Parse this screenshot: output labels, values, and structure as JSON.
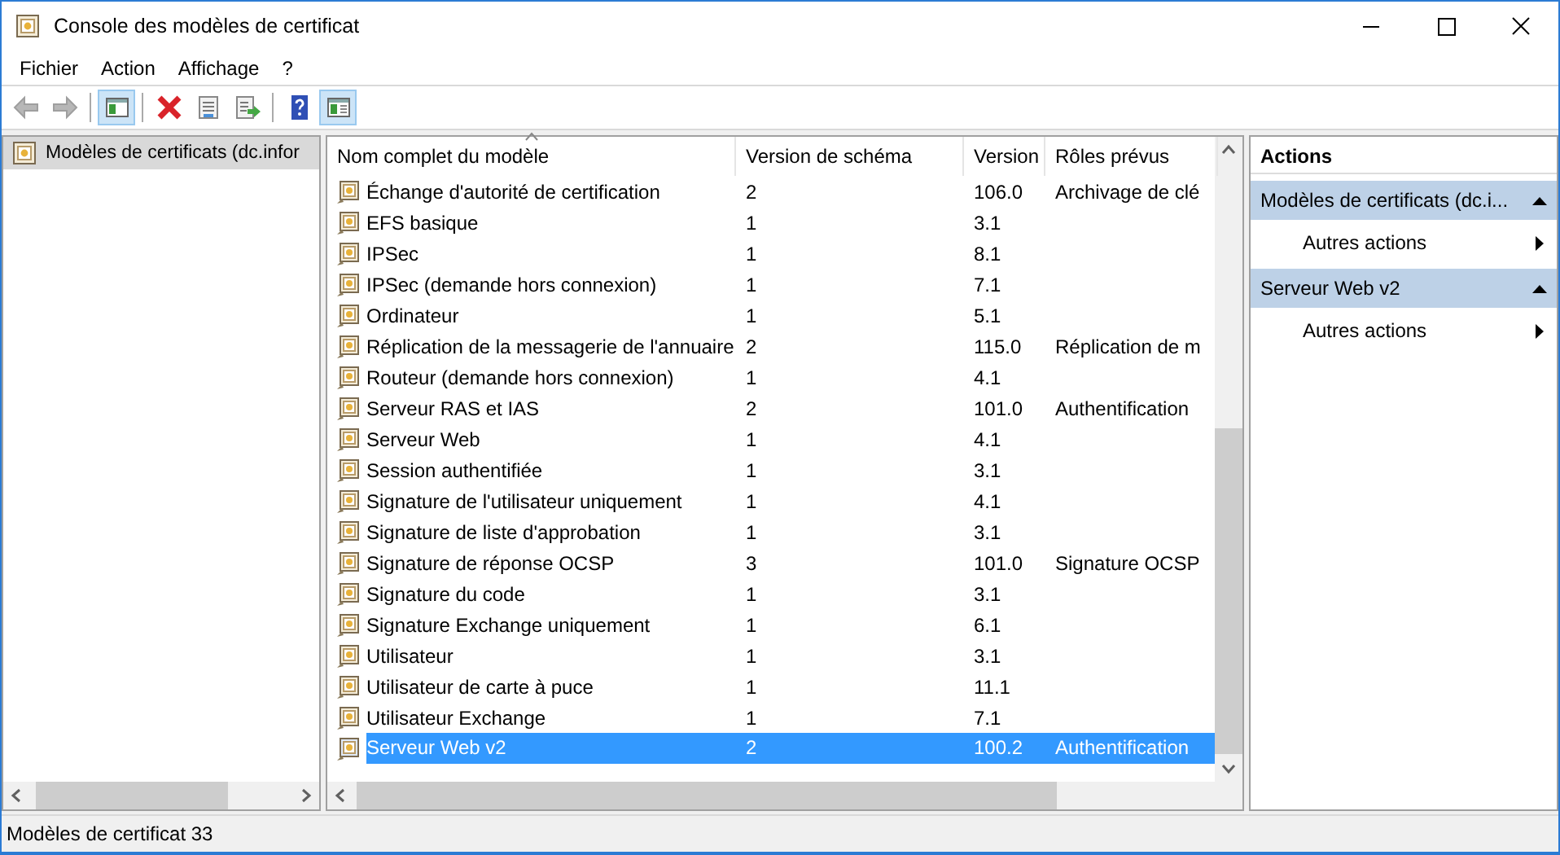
{
  "window": {
    "title": "Console des modèles de certificat"
  },
  "menu": [
    "Fichier",
    "Action",
    "Affichage",
    "?"
  ],
  "toolbar": [
    {
      "kind": "back",
      "disabled": true,
      "pressed": false
    },
    {
      "kind": "forward",
      "disabled": true,
      "pressed": false
    },
    {
      "kind": "tree-pane",
      "disabled": false,
      "pressed": true
    },
    {
      "kind": "delete",
      "disabled": false,
      "pressed": false
    },
    {
      "kind": "properties",
      "disabled": false,
      "pressed": false
    },
    {
      "kind": "export",
      "disabled": false,
      "pressed": false
    },
    {
      "kind": "help",
      "disabled": false,
      "pressed": false
    },
    {
      "kind": "action-pane",
      "disabled": false,
      "pressed": true
    }
  ],
  "tree": {
    "items": [
      {
        "label": "Modèles de certificats (dc.infor",
        "selected": true
      }
    ]
  },
  "table": {
    "columns": [
      {
        "label": "Nom complet du modèle",
        "sorted": true
      },
      {
        "label": "Version de schéma",
        "sorted": false
      },
      {
        "label": "Version",
        "sorted": false
      },
      {
        "label": "Rôles prévus",
        "sorted": false
      }
    ],
    "rows": [
      {
        "name": "Échange d'autorité de certification",
        "schema": "2",
        "version": "106.0",
        "roles": "Archivage de clé",
        "selected": false
      },
      {
        "name": "EFS basique",
        "schema": "1",
        "version": "3.1",
        "selected": false
      },
      {
        "name": "IPSec",
        "schema": "1",
        "version": "8.1",
        "selected": false
      },
      {
        "name": "IPSec (demande hors connexion)",
        "schema": "1",
        "version": "7.1",
        "selected": false
      },
      {
        "name": "Ordinateur",
        "schema": "1",
        "version": "5.1",
        "selected": false
      },
      {
        "name": "Réplication de la messagerie de l'annuaire",
        "schema": "2",
        "version": "115.0",
        "roles": "Réplication de m",
        "selected": false
      },
      {
        "name": "Routeur (demande hors connexion)",
        "schema": "1",
        "version": "4.1",
        "selected": false
      },
      {
        "name": "Serveur RAS et IAS",
        "schema": "2",
        "version": "101.0",
        "roles": "Authentification",
        "selected": false
      },
      {
        "name": "Serveur Web",
        "schema": "1",
        "version": "4.1",
        "selected": false
      },
      {
        "name": "Session authentifiée",
        "schema": "1",
        "version": "3.1",
        "selected": false
      },
      {
        "name": "Signature de l'utilisateur uniquement",
        "schema": "1",
        "version": "4.1",
        "selected": false
      },
      {
        "name": "Signature de liste d'approbation",
        "schema": "1",
        "version": "3.1",
        "selected": false
      },
      {
        "name": "Signature de réponse OCSP",
        "schema": "3",
        "version": "101.0",
        "roles": "Signature OCSP",
        "selected": false
      },
      {
        "name": "Signature du code",
        "schema": "1",
        "version": "3.1",
        "selected": false
      },
      {
        "name": "Signature Exchange uniquement",
        "schema": "1",
        "version": "6.1",
        "selected": false
      },
      {
        "name": "Utilisateur",
        "schema": "1",
        "version": "3.1",
        "selected": false
      },
      {
        "name": "Utilisateur de carte à puce",
        "schema": "1",
        "version": "11.1",
        "selected": false
      },
      {
        "name": "Utilisateur Exchange",
        "schema": "1",
        "version": "7.1",
        "selected": false
      },
      {
        "name": "Serveur Web v2",
        "schema": "2",
        "version": "100.2",
        "roles": "Authentification",
        "selected": true
      }
    ]
  },
  "actions": {
    "title": "Actions",
    "sections": [
      {
        "title": "Modèles de certificats (dc.i...",
        "expanded": true,
        "items": [
          "Autres actions"
        ]
      },
      {
        "title": "Serveur Web v2",
        "expanded": true,
        "items": [
          "Autres actions"
        ]
      }
    ]
  },
  "status_bar": "Modèles de certificat 33"
}
